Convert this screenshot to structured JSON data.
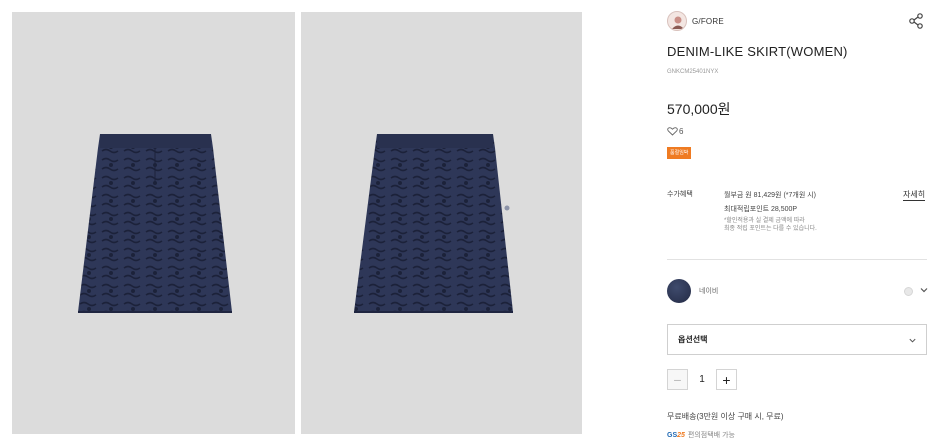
{
  "gallery": {
    "images": [
      {
        "alt": "front",
        "color": "#2c3552"
      },
      {
        "alt": "back",
        "color": "#2c3552"
      }
    ],
    "background": "#dcdcdc"
  },
  "brand": {
    "name": "G/FORE",
    "logo_icon": "brand-logo"
  },
  "product": {
    "title": "DENIM-LIKE SKIRT(WOMEN)",
    "code": "GNKCM25401NYX",
    "price": "570,000원",
    "likes": "6",
    "badge": "품절임박",
    "badge_color": "#ef7b22"
  },
  "benefits": {
    "label": "수가혜택",
    "installment": "월부금 원 81,429원 (*7개원 시)",
    "points": "최대적립포인트 28,500P",
    "note_1": "*할인적용과 실 결제 금액에 따라",
    "note_2": "최종 적립 포인트는 다를 수 있습니다.",
    "detail_link": "자세히"
  },
  "color_option": {
    "name": "네이비",
    "swatch": "#2c3552"
  },
  "option_select": {
    "placeholder": "옵션선택"
  },
  "quantity": {
    "value": "1",
    "minus": "−",
    "plus": "+"
  },
  "shipping": {
    "text": "무료배송(3만원 이상 구매 시, 무료)"
  },
  "gs": {
    "logo_prefix": "GS",
    "logo_number": "25",
    "text": "편의점택배 가능"
  }
}
